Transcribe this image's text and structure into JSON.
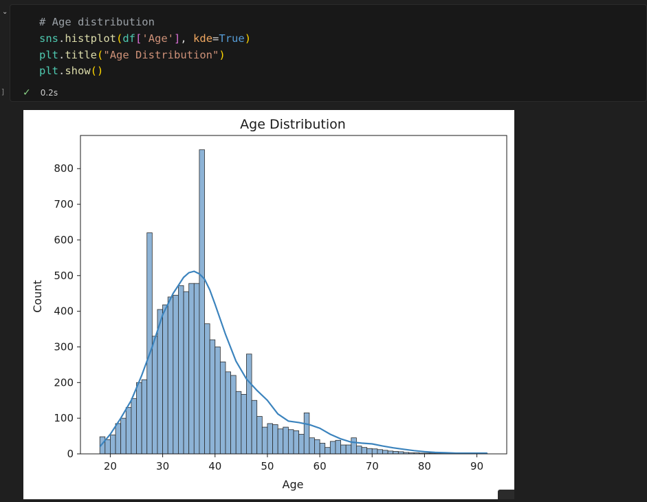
{
  "cell": {
    "code_lines": {
      "comment": "# Age distribution",
      "l2": {
        "a": "sns",
        "b": ".",
        "c": "histplot",
        "d": "(",
        "e": "df",
        "f": "[",
        "g": "'Age'",
        "h": "]",
        "i": ", ",
        "j": "kde",
        "k": "=",
        "l": "True",
        "m": ")"
      },
      "l3": {
        "a": "plt",
        "b": ".",
        "c": "title",
        "d": "(",
        "e": "\"Age Distribution\"",
        "f": ")"
      },
      "l4": {
        "a": "plt",
        "b": ".",
        "c": "show",
        "d": "()"
      }
    },
    "exec_time": "0.2s",
    "status_icon": "check-icon",
    "collapse_icon": "chevron-down-icon"
  },
  "colors": {
    "bar_fill": "#8db3d6",
    "bar_edge": "#2b2b2b",
    "kde_line": "#3b83bd"
  },
  "chart_data": {
    "type": "bar",
    "title": "Age Distribution",
    "xlabel": "Age",
    "ylabel": "Count",
    "xlim": [
      14.3,
      95.7
    ],
    "ylim": [
      0,
      893
    ],
    "xticks": [
      20,
      30,
      40,
      50,
      60,
      70,
      80,
      90
    ],
    "yticks": [
      0,
      100,
      200,
      300,
      400,
      500,
      600,
      700,
      800
    ],
    "bin_start": 18,
    "bin_width": 1,
    "counts": [
      48,
      40,
      53,
      85,
      100,
      130,
      155,
      200,
      208,
      620,
      330,
      405,
      418,
      440,
      445,
      472,
      455,
      478,
      478,
      853,
      365,
      320,
      300,
      258,
      230,
      220,
      175,
      167,
      280,
      150,
      105,
      75,
      85,
      82,
      70,
      75,
      68,
      65,
      55,
      115,
      45,
      40,
      30,
      18,
      35,
      38,
      25,
      25,
      45,
      22,
      18,
      15,
      14,
      12,
      10,
      8,
      7,
      6,
      4,
      3,
      3,
      2,
      2,
      2,
      1,
      1,
      1,
      1,
      1,
      1,
      1,
      1,
      1,
      1
    ],
    "kde": {
      "x": [
        18,
        20,
        22,
        24,
        26,
        28,
        30,
        32,
        34,
        35,
        36,
        37,
        38,
        39,
        40,
        42,
        44,
        46,
        48,
        50,
        52,
        54,
        56,
        58,
        60,
        62,
        64,
        66,
        68,
        70,
        72,
        74,
        76,
        78,
        80,
        82,
        84,
        86,
        88,
        90,
        92
      ],
      "y": [
        20,
        55,
        100,
        150,
        220,
        300,
        390,
        450,
        495,
        508,
        512,
        505,
        490,
        460,
        420,
        335,
        260,
        210,
        178,
        150,
        112,
        92,
        88,
        82,
        72,
        55,
        42,
        33,
        30,
        28,
        22,
        17,
        13,
        9,
        6,
        4,
        3,
        2,
        2,
        2,
        2
      ]
    }
  }
}
